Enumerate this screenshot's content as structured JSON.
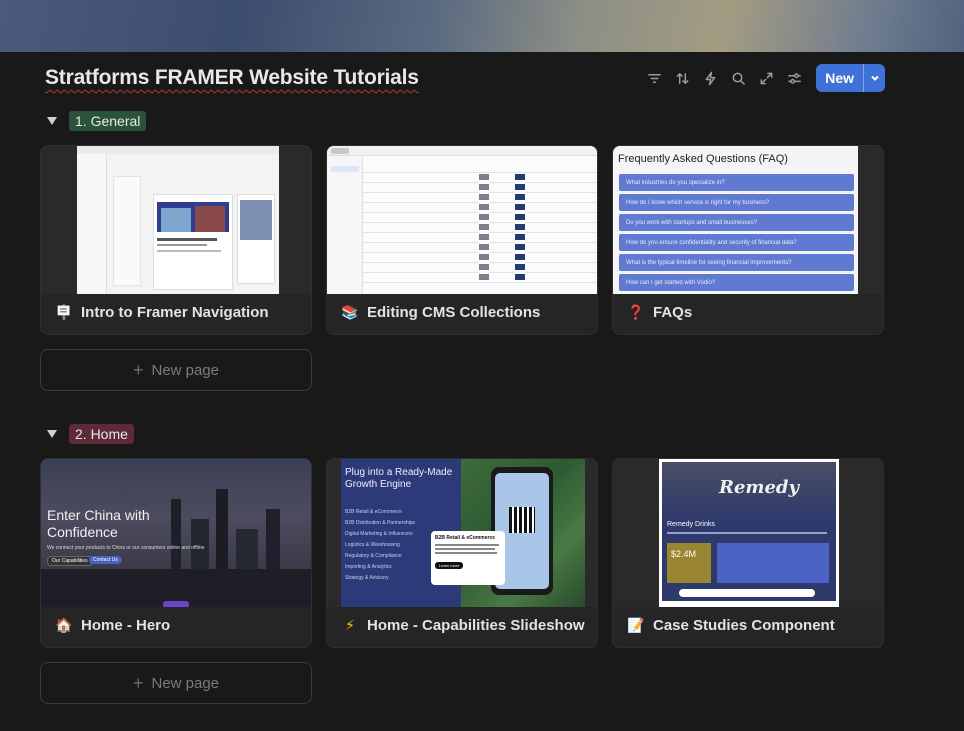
{
  "page": {
    "title": "Stratforms FRAMER Website Tutorials"
  },
  "toolbar": {
    "icons": [
      "filter-icon",
      "sort-icon",
      "automation-icon",
      "search-icon",
      "expand-icon",
      "settings-icon"
    ],
    "new_label": "New"
  },
  "groups": [
    {
      "label": "1. General",
      "color": "#2b5339",
      "cards": [
        {
          "emoji": "🪧",
          "title": "Intro to Framer Navigation"
        },
        {
          "emoji": "📚",
          "title": "Editing CMS Collections"
        },
        {
          "emoji": "❓",
          "title": "FAQs"
        }
      ],
      "new_page_label": "New page"
    },
    {
      "label": "2. Home",
      "color": "#5c2b37",
      "cards": [
        {
          "emoji": "🏠",
          "title": "Home - Hero"
        },
        {
          "emoji": "⚡",
          "title": "Home - Capabilities Slideshow"
        },
        {
          "emoji": "📝",
          "title": "Case Studies Component"
        }
      ],
      "new_page_label": "New page"
    }
  ],
  "thumbnails": {
    "faq": {
      "heading": "Frequently Asked Questions (FAQ)",
      "items": [
        "What industries do you specialize in?",
        "How do I know which service is right for my business?",
        "Do you work with startups and small businesses?",
        "How do you ensure confidentiality and security of financial data?",
        "What is the typical timeline for seeing financial improvements?",
        "How can I get started with Vudio?"
      ]
    },
    "hero": {
      "heading": "Enter China with Confidence",
      "sub": "We connect your products to China or our consumers online and offline",
      "btn1": "Our Capabilities",
      "btn2": "Contact Us"
    },
    "capabilities": {
      "heading": "Plug into a Ready-Made Growth Engine",
      "list": [
        "B2B Retail & eCommerce",
        "B2B Distribution & Partnerships",
        "Digital Marketing & Influencers",
        "Logistics & Warehousing",
        "Regulatory & Compliance",
        "Importing & Analytics",
        "Strategy & Advisory"
      ],
      "popup_title": "B2B Retail & eCommerce",
      "popup_btn": "Learn more"
    },
    "case": {
      "logo": "Remedy",
      "name": "Remedy Drinks",
      "stat": "$2.4M"
    }
  }
}
